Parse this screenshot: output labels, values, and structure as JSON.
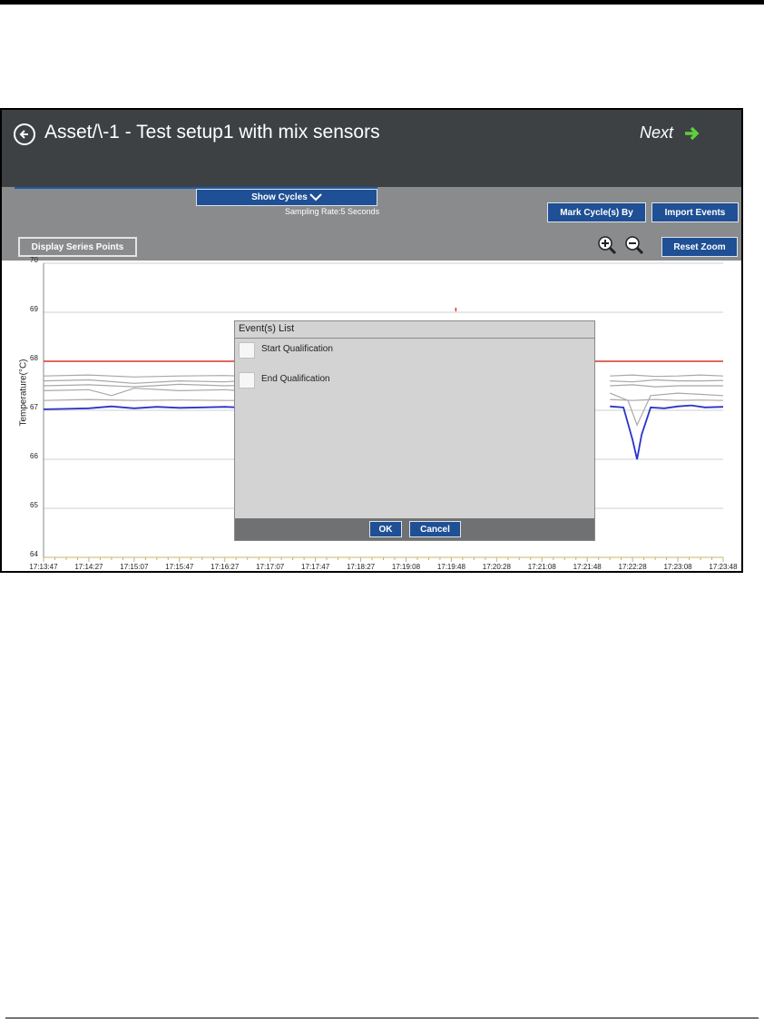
{
  "header": {
    "title": "Asset/\\-1 - Test setup1 with mix sensors",
    "next_label": "Next"
  },
  "toolbar": {
    "show_cycles_label": "Show Cycles",
    "sampling_rate": "Sampling Rate:5 Seconds",
    "mark_cycles_label": "Mark Cycle(s) By",
    "import_events_label": "Import Events",
    "display_series_points_label": "Display Series Points",
    "reset_zoom_label": "Reset Zoom"
  },
  "icons": {
    "back": "back-arrow-circle-icon",
    "next": "right-arrow-icon",
    "show_cycles": "chevron-down-icon",
    "zoom_in": "zoom-in-icon",
    "zoom_out": "zoom-out-icon"
  },
  "dialog": {
    "title": "Event(s) List",
    "events": [
      {
        "label": "Start Qualification",
        "checked": false
      },
      {
        "label": "End Qualification",
        "checked": false
      }
    ],
    "ok_label": "OK",
    "cancel_label": "Cancel"
  },
  "colors": {
    "header_bg": "#3d4143",
    "toolbar_bg": "#898b8d",
    "button_blue": "#1f4f94",
    "limit_line": "#d9342b",
    "highlight_series": "#2a33c7",
    "other_series": "#a8a8a8",
    "next_arrow": "#5fcf3c"
  },
  "chart_data": {
    "type": "line",
    "ylabel": "Temperature(°C)",
    "xlabel": "",
    "ylim": [
      64,
      70
    ],
    "yticks": [
      "70",
      "69",
      "68",
      "67",
      "66",
      "65",
      "64"
    ],
    "x_tick_labels": [
      "17:13:47",
      "17:14:27",
      "17:15:07",
      "17:15:47",
      "17:16:27",
      "17:17:07",
      "17:17:47",
      "17:18:27",
      "17:19:08",
      "17:19:48",
      "17:20:28",
      "17:21:08",
      "17:21:48",
      "17:22:28",
      "17:23:08",
      "17:23:48"
    ],
    "grid": true,
    "limit_line": 68.0,
    "highlight_series": {
      "x": [
        0,
        0.5,
        1,
        1.5,
        2,
        2.5,
        3,
        3.5,
        4,
        4.3,
        12.5,
        12.8,
        13.0,
        13.1,
        13.2,
        13.4,
        13.7,
        14.0,
        14.3,
        14.6,
        15.0
      ],
      "values": [
        67.02,
        67.03,
        67.04,
        67.08,
        67.04,
        67.07,
        67.05,
        67.06,
        67.07,
        67.06,
        67.08,
        67.06,
        66.4,
        66.0,
        66.5,
        67.06,
        67.04,
        67.08,
        67.1,
        67.06,
        67.07
      ]
    },
    "other_series": [
      {
        "x": [
          0,
          1,
          2,
          3,
          4,
          4.3
        ],
        "values": [
          67.7,
          67.72,
          67.68,
          67.7,
          67.71,
          67.7
        ]
      },
      {
        "x": [
          0,
          1,
          2,
          3,
          4,
          4.3
        ],
        "values": [
          67.6,
          67.62,
          67.55,
          67.6,
          67.58,
          67.6
        ]
      },
      {
        "x": [
          0,
          1,
          2,
          3,
          4,
          4.3
        ],
        "values": [
          67.5,
          67.52,
          67.48,
          67.53,
          67.5,
          67.51
        ]
      },
      {
        "x": [
          0,
          1,
          1.5,
          2,
          3,
          4,
          4.3
        ],
        "values": [
          67.4,
          67.42,
          67.3,
          67.45,
          67.4,
          67.42,
          67.4
        ]
      },
      {
        "x": [
          0,
          1,
          2,
          3,
          4,
          4.3
        ],
        "values": [
          67.2,
          67.22,
          67.2,
          67.21,
          67.2,
          67.2
        ]
      },
      {
        "x": [
          12.5,
          13,
          13.5,
          14,
          14.5,
          15
        ],
        "values": [
          67.7,
          67.72,
          67.69,
          67.7,
          67.72,
          67.7
        ]
      },
      {
        "x": [
          12.5,
          13,
          13.5,
          14,
          14.5,
          15
        ],
        "values": [
          67.6,
          67.58,
          67.62,
          67.6,
          67.6,
          67.61
        ]
      },
      {
        "x": [
          12.5,
          13,
          13.5,
          14,
          14.5,
          15
        ],
        "values": [
          67.5,
          67.52,
          67.48,
          67.5,
          67.5,
          67.5
        ]
      },
      {
        "x": [
          12.5,
          12.9,
          13.1,
          13.4,
          14,
          15
        ],
        "values": [
          67.35,
          67.2,
          66.7,
          67.3,
          67.35,
          67.3
        ]
      },
      {
        "x": [
          12.5,
          13,
          13.5,
          14,
          14.5,
          15
        ],
        "values": [
          67.22,
          67.2,
          67.22,
          67.2,
          67.21,
          67.2
        ]
      }
    ]
  }
}
